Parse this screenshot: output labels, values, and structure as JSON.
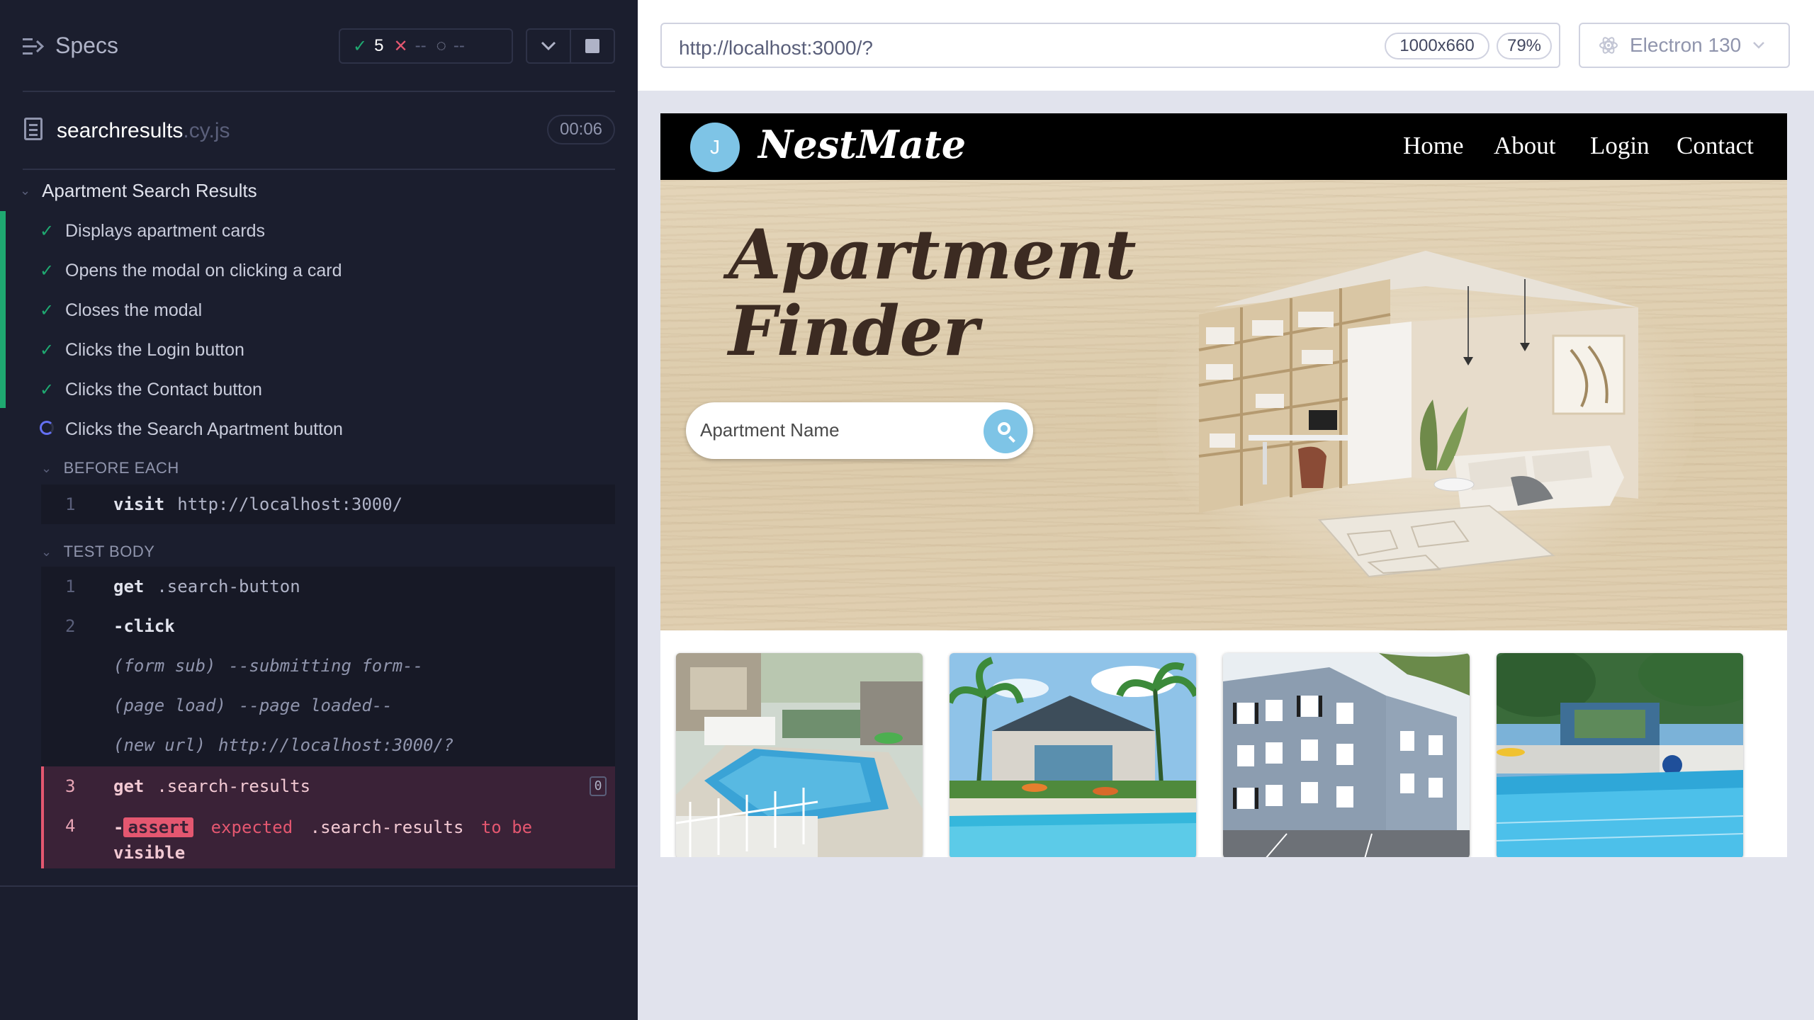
{
  "reporter": {
    "header": {
      "title": "Specs",
      "passed": "5",
      "failed": "--",
      "pending": "--"
    },
    "file": {
      "name": "searchresults",
      "ext": ".cy.js",
      "duration": "00:06"
    },
    "suite": {
      "title": "Apartment Search Results",
      "tests": [
        {
          "label": "Displays apartment cards",
          "state": "passed"
        },
        {
          "label": "Opens the modal on clicking a card",
          "state": "passed"
        },
        {
          "label": "Closes the modal",
          "state": "passed"
        },
        {
          "label": "Clicks the Login button",
          "state": "passed"
        },
        {
          "label": "Clicks the Contact button",
          "state": "passed"
        },
        {
          "label": "Clicks the Search Apartment button",
          "state": "running"
        }
      ]
    },
    "before_each": {
      "title": "BEFORE EACH",
      "commands": [
        {
          "num": "1",
          "name": "visit",
          "arg": "http://localhost:3000/"
        }
      ]
    },
    "test_body": {
      "title": "TEST BODY",
      "commands": [
        {
          "num": "1",
          "name": "get",
          "arg": ".search-button"
        },
        {
          "num": "2",
          "name": "-click",
          "arg": ""
        }
      ],
      "events": [
        {
          "label": "(form sub)",
          "msg": "--submitting form--"
        },
        {
          "label": "(page load)",
          "msg": "--page loaded--"
        },
        {
          "label": "(new url)",
          "msg": "http://localhost:3000/?"
        }
      ],
      "failed_command": {
        "num": "3",
        "name": "get",
        "arg": ".search-results",
        "count": "0"
      },
      "assert": {
        "num": "4",
        "prefix": "-",
        "tag": "assert",
        "word_expected": "expected",
        "selector": ".search-results",
        "to_be": "to be",
        "visible": "visible"
      }
    }
  },
  "aut": {
    "url": "http://localhost:3000/?",
    "viewport": "1000x660",
    "zoom": "79%",
    "browser": "Electron 130"
  },
  "site": {
    "avatar_letter": "J",
    "logo": "NestMate",
    "nav": [
      "Home",
      "About",
      "Login",
      "Contact"
    ],
    "hero_title_line1": "Apartment",
    "hero_title_line2": "Finder",
    "search_placeholder": "Apartment Name"
  },
  "colors": {
    "reporter_bg": "#1b1e2e",
    "pass": "#1fa971",
    "fail": "#e45770",
    "running": "#6470f3",
    "accent_blue": "#7ec4e6"
  }
}
